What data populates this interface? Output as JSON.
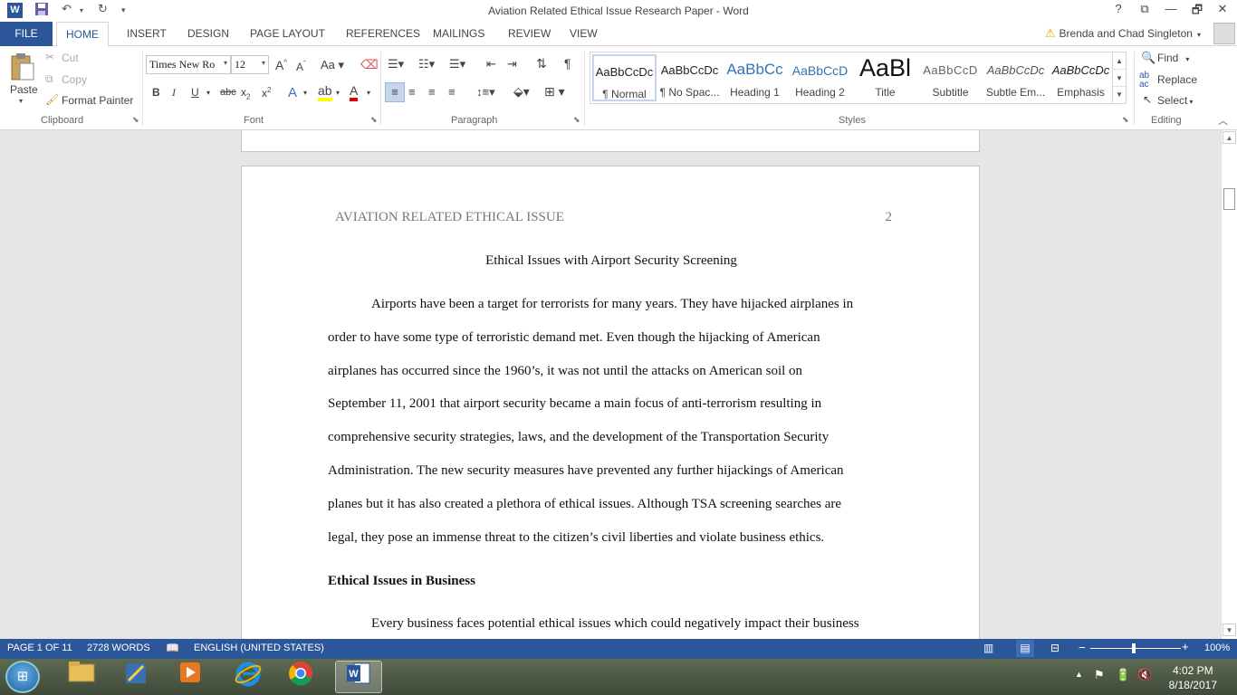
{
  "titlebar": {
    "title": "Aviation Related Ethical Issue Research Paper - Word",
    "app_icon": "W",
    "help": "?",
    "restore_ribbon": "⧉",
    "minimize": "—",
    "maximize": "🗗",
    "close": "✕"
  },
  "tabs": {
    "file": "FILE",
    "home": "HOME",
    "insert": "INSERT",
    "design": "DESIGN",
    "page_layout": "PAGE LAYOUT",
    "references": "REFERENCES",
    "mailings": "MAILINGS",
    "review": "REVIEW",
    "view": "VIEW"
  },
  "user": {
    "name": "Brenda and Chad Singleton"
  },
  "clipboard": {
    "paste": "Paste",
    "cut": "Cut",
    "copy": "Copy",
    "format_painter": "Format Painter",
    "label": "Clipboard"
  },
  "font": {
    "family": "Times New Ro",
    "size": "12",
    "label": "Font"
  },
  "paragraph": {
    "label": "Paragraph"
  },
  "styles": {
    "label": "Styles",
    "items": [
      {
        "sample": "AaBbCcDc",
        "name": "¶ Normal"
      },
      {
        "sample": "AaBbCcDc",
        "name": "¶ No Spac..."
      },
      {
        "sample": "AaBbCc",
        "name": "Heading 1"
      },
      {
        "sample": "AaBbCcD",
        "name": "Heading 2"
      },
      {
        "sample": "AaBl",
        "name": "Title"
      },
      {
        "sample": "AaBbCcD",
        "name": "Subtitle"
      },
      {
        "sample": "AaBbCcDc",
        "name": "Subtle Em..."
      },
      {
        "sample": "AaBbCcDc",
        "name": "Emphasis"
      }
    ]
  },
  "editing": {
    "find": "Find",
    "replace": "Replace",
    "select": "Select",
    "label": "Editing"
  },
  "document": {
    "running_head": "AVIATION RELATED ETHICAL ISSUE",
    "page_number": "2",
    "title": "Ethical Issues with Airport Security Screening",
    "lines": [
      "Airports have been a target for terrorists for many years. They have hijacked airplanes in",
      "order to have some type of terroristic demand met. Even though the hijacking of American",
      "airplanes has occurred since the 1960’s, it was not until the attacks on American soil on",
      "September 11, 2001 that airport security became a main focus of anti-terrorism resulting in",
      "comprehensive security strategies, laws, and the development of the Transportation Security",
      "Administration. The new security measures have prevented any further hijackings of American",
      "planes but it has also created a plethora of ethical issues. Although TSA screening searches are",
      "legal, they pose an immense threat to the citizen’s civil liberties and violate business ethics."
    ],
    "heading": "Ethical Issues in Business",
    "next_line": "Every business faces potential ethical issues which could negatively impact their business"
  },
  "statusbar": {
    "page": "PAGE 1 OF 11",
    "words": "2728 WORDS",
    "language": "ENGLISH (UNITED STATES)",
    "zoom": "100%",
    "zoom_level_percent": 100
  },
  "taskbar": {
    "time": "4:02 PM",
    "date": "8/18/2017"
  },
  "colors": {
    "accent": "#2b579a",
    "doc_background": "#e6e6e6"
  }
}
